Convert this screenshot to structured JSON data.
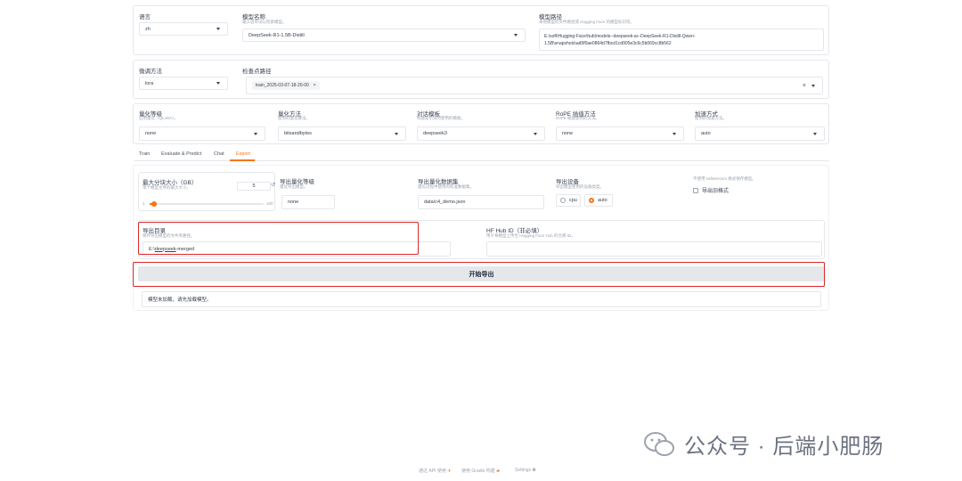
{
  "top": {
    "lang_label": "语言",
    "lang_value": "zh",
    "model_name_label": "模型名称",
    "model_name_sub": "输入首单词以检索模型。",
    "model_name_value": "DeepSeek-R1-1.5B-Distill",
    "model_path_label": "模型路径",
    "model_path_sub": "本地模型的文件路径或 Hugging Face 的模型标识符。",
    "model_path_value_1": "E:\\soft\\Hugging-Face\\hub\\models--deepseek-ai--DeepSeek-R1-Distill-Qwen-",
    "model_path_value_2": "1.5B\\snapshots\\ad9f0ae0864d7fbcd1cd905e3c6c5b069cc8b562"
  },
  "finetune": {
    "method_label": "微调方法",
    "method_value": "lora",
    "ckpt_label": "检查点路径",
    "ckpt_tag": "train_2025-03-07-18-20-00",
    "ckpt_tag_close": "×",
    "ckpt_clear": "×"
  },
  "advanced": {
    "quant_bit_label": "量化等级",
    "quant_bit_sub": "启用量化（QLoRA）。",
    "quant_bit_value": "none",
    "quant_method_label": "量化方法",
    "quant_method_sub": "使用的量化算法。",
    "quant_method_value": "bitsandbytes",
    "template_label": "对话模板",
    "template_sub": "构建提示词时使用的模板。",
    "template_value": "deepseek3",
    "rope_label": "RoPE 插值方法",
    "rope_sub": "RoPE 缩放使用的方法。",
    "rope_value": "none",
    "booster_label": "加速方式",
    "booster_sub": "使用的加速方法。",
    "booster_value": "auto"
  },
  "tabs": [
    "Train",
    "Evaluate & Predict",
    "Chat",
    "Export"
  ],
  "export": {
    "shard_label": "最大分块大小（GB）",
    "shard_sub": "单个模型文件的最大大小。",
    "shard_value": "5",
    "shard_reset": "↺",
    "shard_min": "1",
    "shard_max": "100",
    "shard_fraction": 0.04,
    "quant_bit_label": "导出量化等级",
    "quant_bit_sub": "量化导出模型。",
    "quant_bit_value": "none",
    "quant_dataset_label": "导出量化数据集",
    "quant_dataset_sub": "量化过程中使用的校准数据集。",
    "quant_dataset_value": "data/c4_demo.json",
    "device_label": "导出设备",
    "device_sub": "导出模型使用的设备类型。",
    "device_cpu": "cpu",
    "device_auto": "auto",
    "legacy_sub": "不使用 safetensors 格式保存模型。",
    "legacy_label": "导出旧格式",
    "dir_label": "导出目录",
    "dir_sub": "保存导出模型的文件夹路径。",
    "dir_value_prefix": "E:\\",
    "dir_value_link": "deepseek",
    "dir_value_suffix": "-merged",
    "hub_label": "HF Hub ID（非必填）",
    "hub_sub": "用于将模型上传至 Hugging Face Hub 的仓库 ID。",
    "start_button": "开始导出",
    "status_text": "模型未加载，请先加载模型。"
  },
  "watermark": {
    "text": "公众号 · 后端小肥肠"
  },
  "footer": {
    "api": "通过 API 使用",
    "gradio": "使用 Gradio 构建",
    "settings": "Settings"
  },
  "colors": {
    "accent": "#f97316",
    "highlight": "#dc2626",
    "border": "#e5e7eb"
  }
}
